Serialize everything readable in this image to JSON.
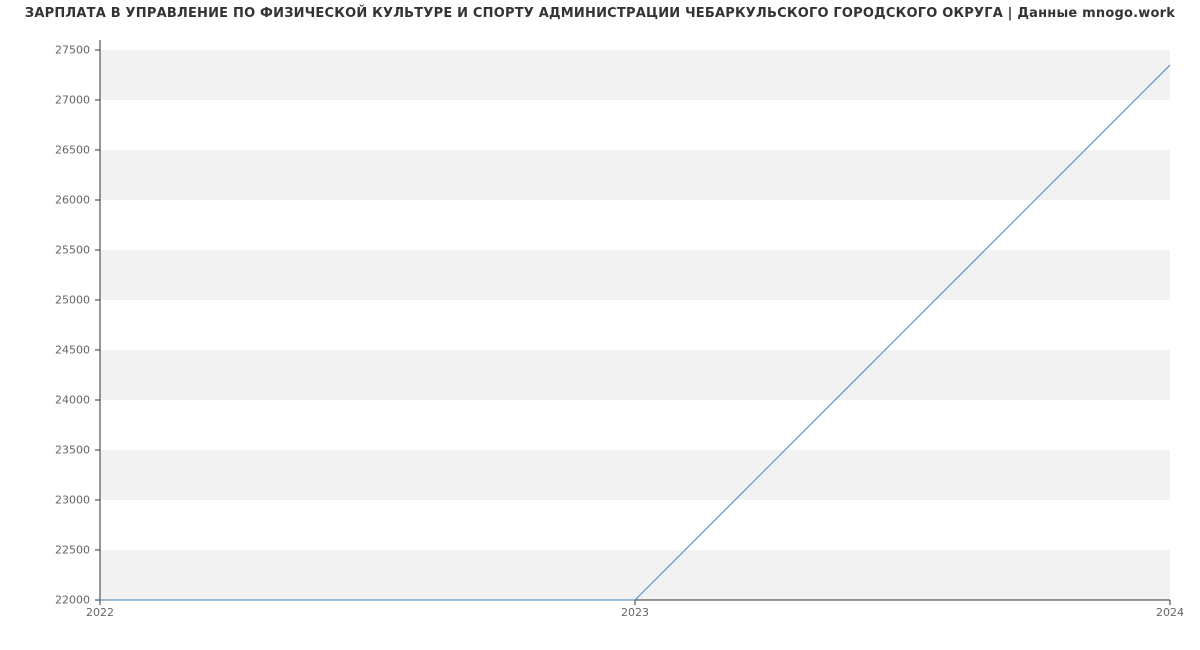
{
  "chart_data": {
    "type": "line",
    "title": "ЗАРПЛАТА В УПРАВЛЕНИЕ ПО ФИЗИЧЕСКОЙ КУЛЬТУРЕ И СПОРТУ АДМИНИСТРАЦИИ ЧЕБАРКУЛЬСКОГО ГОРОДСКОГО ОКРУГА | Данные mnogo.work",
    "x": [
      2022,
      2023,
      2024
    ],
    "values": [
      22000,
      22000,
      27350
    ],
    "x_ticks": [
      2022,
      2023,
      2024
    ],
    "y_ticks": [
      22000,
      22500,
      23000,
      23500,
      24000,
      24500,
      25000,
      25500,
      26000,
      26500,
      27000,
      27500
    ],
    "xlim": [
      2022,
      2024
    ],
    "ylim": [
      22000,
      27600
    ],
    "line_color": "#6699cc",
    "grid_band_color": "#f2f2f2",
    "axis_color": "#333333"
  }
}
